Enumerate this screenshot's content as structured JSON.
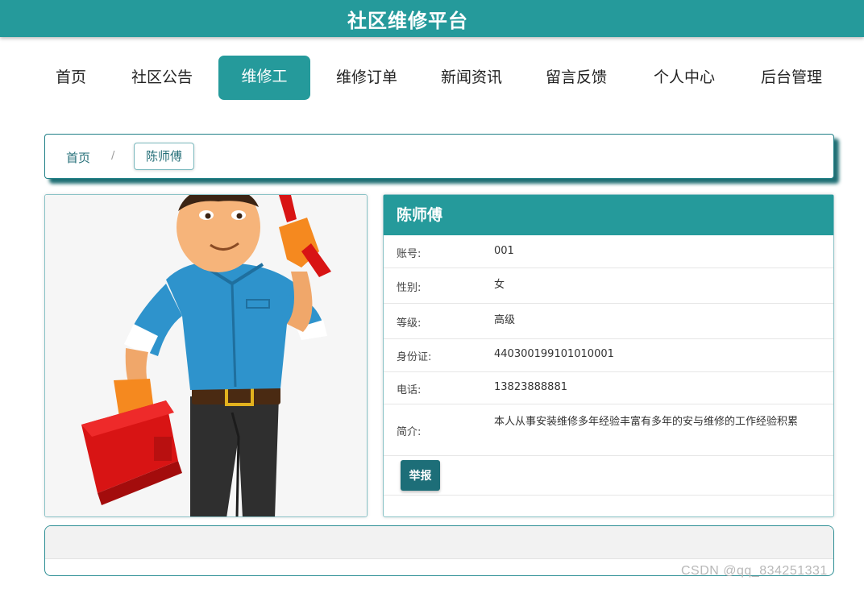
{
  "header": {
    "title": "社区维修平台"
  },
  "nav": {
    "items": [
      {
        "label": "首页"
      },
      {
        "label": "社区公告"
      },
      {
        "label": "维修工"
      },
      {
        "label": "维修订单"
      },
      {
        "label": "新闻资讯"
      },
      {
        "label": "留言反馈"
      },
      {
        "label": "个人中心"
      },
      {
        "label": "后台管理"
      }
    ],
    "active": "维修工"
  },
  "breadcrumb": {
    "home": "首页",
    "separator": "/",
    "current": "陈师傅"
  },
  "worker": {
    "name": "陈师傅",
    "photo_icon": "repairman-illustration",
    "fields": [
      {
        "label": "账号:",
        "value": "001"
      },
      {
        "label": "性别:",
        "value": "女"
      },
      {
        "label": "等级:",
        "value": "高级"
      },
      {
        "label": "身份证:",
        "value": "440300199101010001"
      },
      {
        "label": "电话:",
        "value": "13823888881"
      },
      {
        "label": "简介:",
        "value": "本人从事安装维修多年经验丰富有多年的安与维修的工作经验积累"
      }
    ],
    "report_label": "举报"
  },
  "watermark": "CSDN @qq_834251331",
  "colors": {
    "primary": "#259a9b",
    "dark": "#1d6e78",
    "border": "#1f7f86"
  }
}
